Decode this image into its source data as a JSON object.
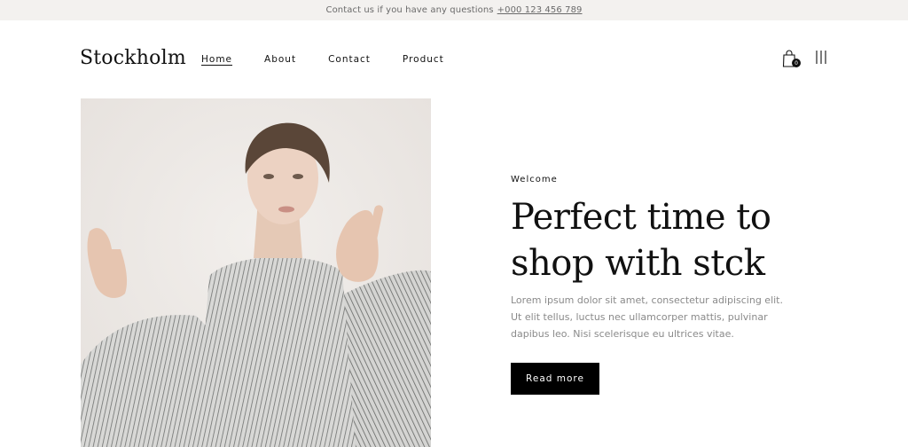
{
  "topbar": {
    "message": "Contact us if you have any questions",
    "phone": "+000 123 456 789"
  },
  "header": {
    "logo": "Stockholm",
    "nav": [
      {
        "label": "Home",
        "active": true
      },
      {
        "label": "About"
      },
      {
        "label": "Contact"
      },
      {
        "label": "Product"
      }
    ],
    "cart_count": "0",
    "icons": [
      "shopping-bag-icon",
      "menu-icon"
    ]
  },
  "hero": {
    "eyebrow": "Welcome",
    "title": "Perfect time to shop with stck",
    "description": "Lorem ipsum dolor sit amet, consectetur adipiscing elit. Ut elit tellus, luctus nec ullamcorper mattis, pulvinar dapibus leo. Nisi scelerisque eu ultrices vitae.",
    "button_label": "Read more"
  },
  "colors": {
    "topbar_bg": "#f3f1ef",
    "text": "#111111",
    "muted": "#8a8a8a",
    "button_bg": "#000000",
    "image_bg": "#efebe8"
  }
}
